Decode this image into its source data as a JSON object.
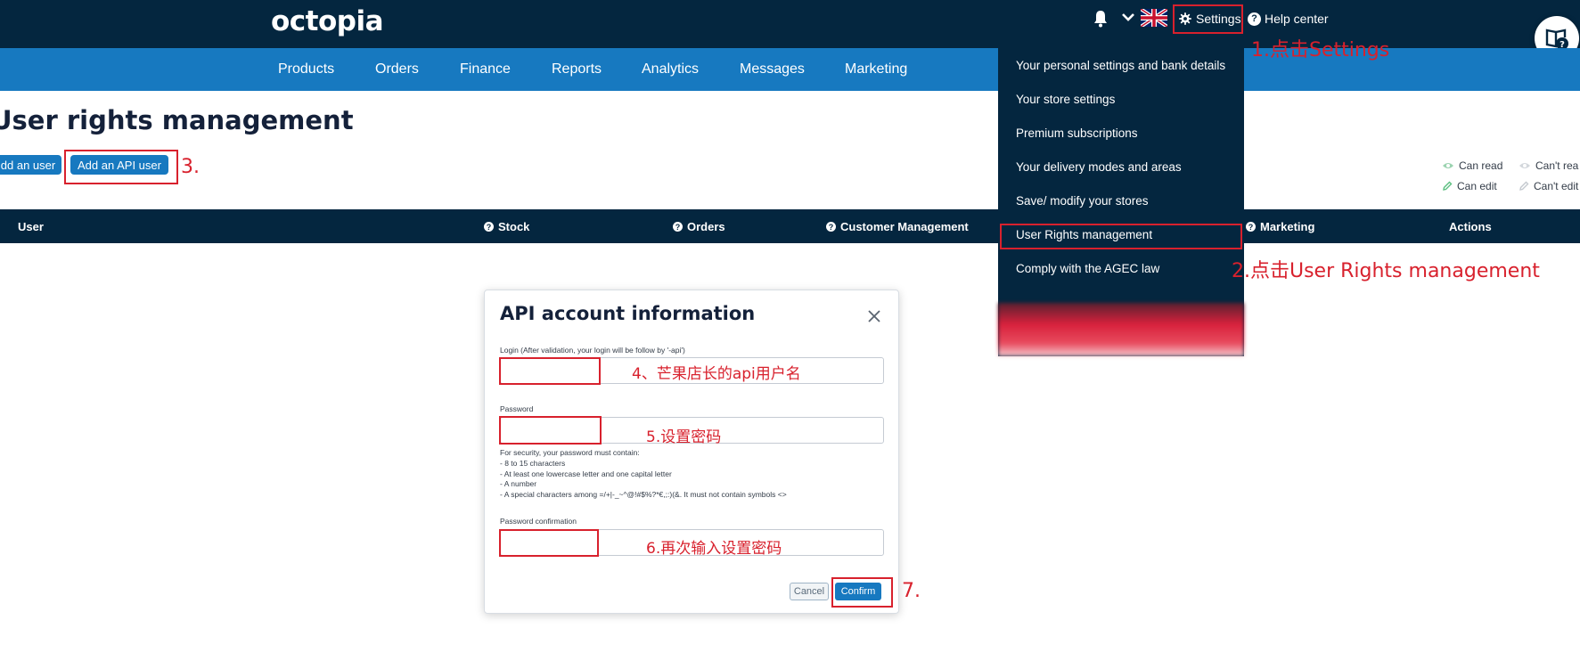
{
  "header": {
    "logo": "octopia",
    "settings_label": "Settings",
    "help_label": "Help center"
  },
  "nav": {
    "items": [
      "Products",
      "Orders",
      "Finance",
      "Reports",
      "Analytics",
      "Messages",
      "Marketing"
    ]
  },
  "page": {
    "title": "User rights management",
    "add_user_label": "dd an user",
    "add_api_user_label": "Add an API user"
  },
  "legend": {
    "can_read": "Can read",
    "cant_read": "Can't rea",
    "can_edit": "Can edit",
    "cant_edit": "Can't edit"
  },
  "table": {
    "headers": [
      "User",
      "Stock",
      "Orders",
      "Customer Management",
      "Marketing",
      "Actions"
    ]
  },
  "settings_menu": {
    "items": [
      "Your personal settings and bank details",
      "Your store settings",
      "Premium subscriptions",
      "Your delivery modes and areas",
      "Save/ modify your stores",
      "User Rights management",
      "Comply with the AGEC law"
    ]
  },
  "modal": {
    "title": "API account information",
    "login_label": "Login (After validation, your login will be follow by '-api')",
    "password_label": "Password",
    "password_rules": [
      "For security, your password must contain:",
      "- 8 to 15 characters",
      "- At least one lowercase letter and one capital letter",
      "- A number",
      "- A special characters among =/+|-_~^@!#$%?*€,;:)(&. It must not contain symbols <>"
    ],
    "confirm_label": "Password confirmation",
    "cancel_button": "Cancel",
    "confirm_button": "Confirm"
  },
  "annotations": {
    "step1": "1.点击Settings",
    "step2": "2.点击User Rights management",
    "step3": "3.",
    "step4": "4、芒果店长的api用户名",
    "step5": "5.设置密码",
    "step6": "6.再次输入设置密码",
    "step7": "7."
  },
  "colors": {
    "dark_navy": "#04263f",
    "brand_blue": "#1779c0",
    "annotation_red": "#d8212d"
  }
}
